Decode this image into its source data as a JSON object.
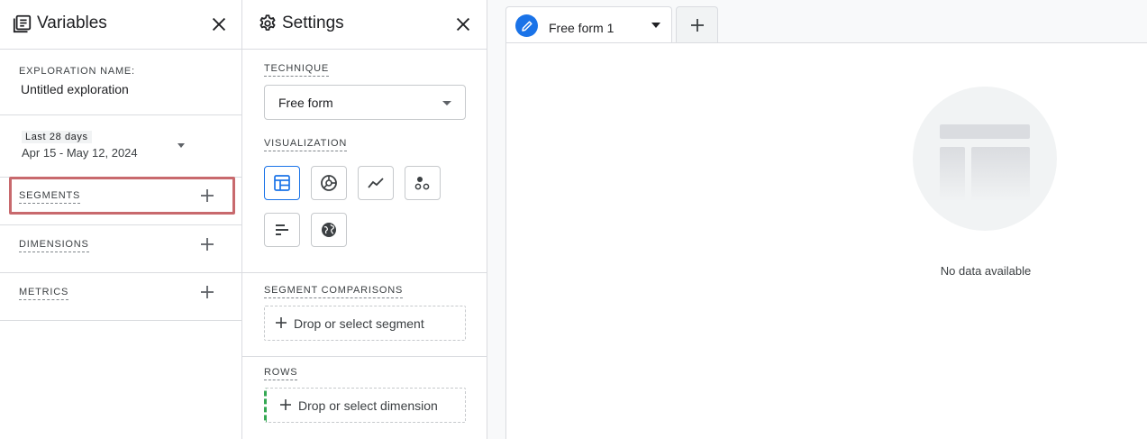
{
  "variables": {
    "title": "Variables",
    "exploration_name_label": "EXPLORATION NAME:",
    "exploration_name_value": "Untitled exploration",
    "date_chip": "Last 28 days",
    "date_range": "Apr 15 - May 12, 2024",
    "rows": {
      "segments": "SEGMENTS",
      "dimensions": "DIMENSIONS",
      "metrics": "METRICS"
    }
  },
  "settings": {
    "title": "Settings",
    "technique_label": "TECHNIQUE",
    "technique_value": "Free form",
    "visualization_label": "VISUALIZATION",
    "visualization_options": [
      "table-icon",
      "donut-chart-icon",
      "line-chart-icon",
      "scatter-plot-icon",
      "bar-chart-icon",
      "geo-map-icon"
    ],
    "visualization_selected": "table-icon",
    "segment_comparisons_label": "SEGMENT COMPARISONS",
    "segment_drop_text": "Drop or select segment",
    "rows_label": "ROWS",
    "rows_drop_text": "Drop or select dimension"
  },
  "canvas": {
    "tab_label": "Free form 1",
    "empty_message": "No data available"
  },
  "colors": {
    "accent": "#1a73e8",
    "highlight": "#c8696d",
    "rows_marker": "#34a853",
    "divider": "#dadce0"
  }
}
